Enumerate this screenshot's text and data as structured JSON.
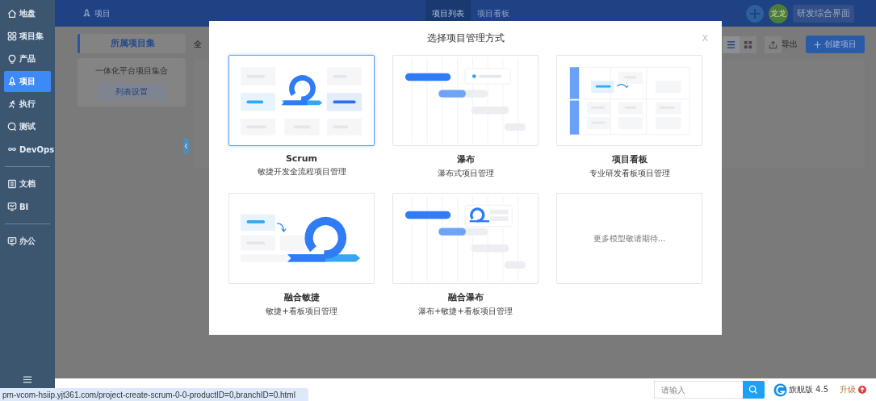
{
  "sidebar": {
    "groups": [
      [
        {
          "label": "地盘",
          "selected": false
        },
        {
          "label": "项目集",
          "selected": false
        },
        {
          "label": "产品",
          "selected": false
        },
        {
          "label": "项目",
          "selected": true
        },
        {
          "label": "执行",
          "selected": false
        },
        {
          "label": "测试",
          "selected": false
        },
        {
          "label": "DevOps",
          "selected": false
        }
      ],
      [
        {
          "label": "文档",
          "selected": false
        },
        {
          "label": "BI",
          "selected": false
        }
      ],
      [
        {
          "label": "办公",
          "selected": false
        }
      ]
    ]
  },
  "top_bar": {
    "module": "项目",
    "tabs": [
      {
        "label": "项目列表",
        "selected": true
      },
      {
        "label": "项目看板",
        "selected": false
      }
    ],
    "avatar": "龙龙",
    "workspace": "研发综合界面"
  },
  "background": {
    "side_tab": "所属项目集",
    "filter_tab": "全",
    "program_card": {
      "title": "一体化平台项目集合",
      "button": "列表设置"
    },
    "views": [
      {
        "selected": true
      },
      {
        "selected": false
      }
    ],
    "export": "导出",
    "create": "创建项目"
  },
  "modal": {
    "title": "选择项目管理方式",
    "close": "X",
    "options": [
      {
        "kind": "scrum",
        "title": "Scrum",
        "subtitle": "敏捷开发全流程项目管理",
        "selected": true
      },
      {
        "kind": "waterfall",
        "title": "瀑布",
        "subtitle": "瀑布式项目管理",
        "selected": false
      },
      {
        "kind": "kanban",
        "title": "项目看板",
        "subtitle": "专业研发看板项目管理",
        "selected": false
      },
      {
        "kind": "agile_kanban",
        "title": "融合敏捷",
        "subtitle": "敏捷+看板项目管理",
        "selected": false
      },
      {
        "kind": "waterfall_mix",
        "title": "融合瀑布",
        "subtitle": "瀑布+敏捷+看板项目管理",
        "selected": false
      },
      {
        "kind": "placeholder",
        "note": "更多模型敬请期待...",
        "selected": false
      }
    ]
  },
  "footer": {
    "search": {
      "placeholder": "请输入"
    },
    "edition": "旗舰版 4.5",
    "upgrade": "升级"
  },
  "status_url": "pm-vcom-hsiip.yjt361.com/project-create-scrum-0-0-productID=0,branchID=0.html"
}
